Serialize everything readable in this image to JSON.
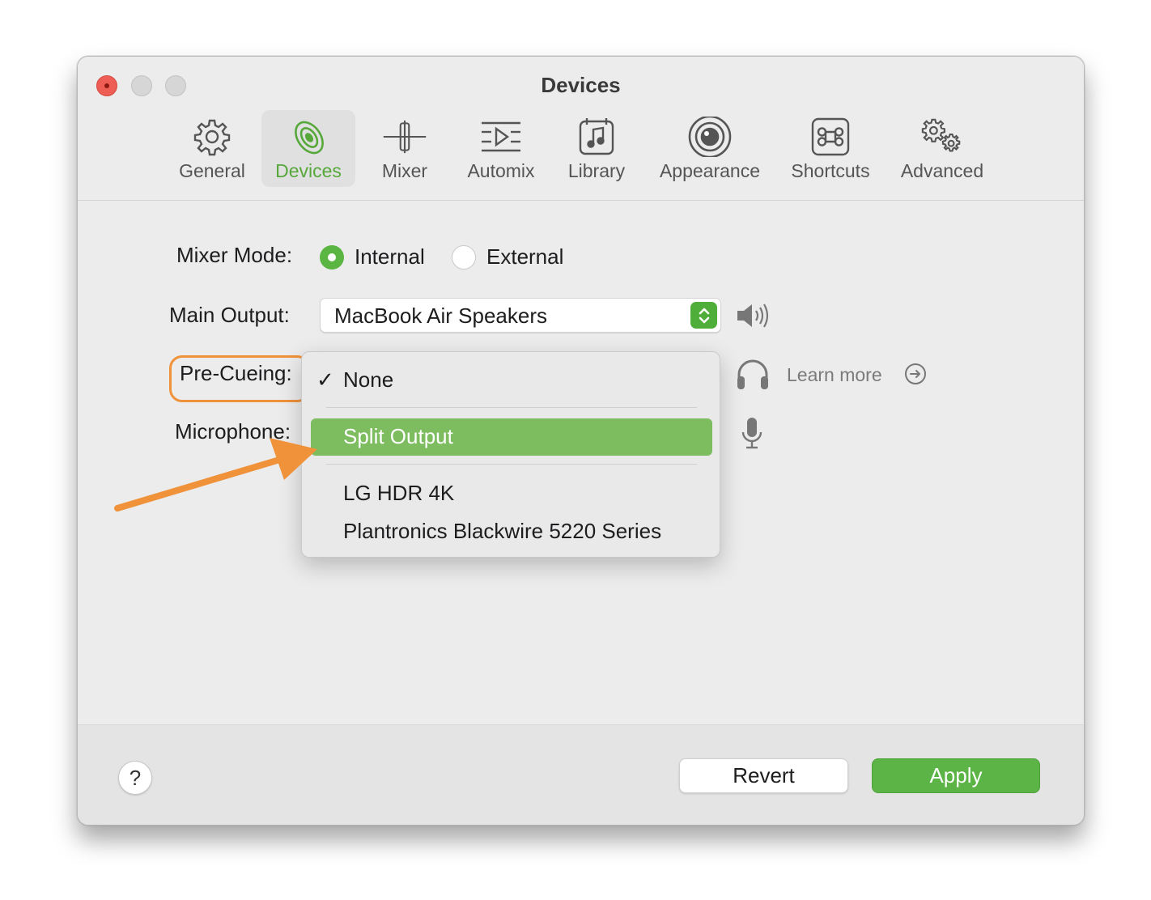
{
  "window": {
    "title": "Devices"
  },
  "toolbar": {
    "tabs": [
      {
        "label": "General",
        "icon": "gear-icon",
        "active": false
      },
      {
        "label": "Devices",
        "icon": "speaker-icon",
        "active": true
      },
      {
        "label": "Mixer",
        "icon": "fader-icon",
        "active": false
      },
      {
        "label": "Automix",
        "icon": "automix-icon",
        "active": false
      },
      {
        "label": "Library",
        "icon": "music-note-icon",
        "active": false
      },
      {
        "label": "Appearance",
        "icon": "eye-icon",
        "active": false
      },
      {
        "label": "Shortcuts",
        "icon": "command-key-icon",
        "active": false
      },
      {
        "label": "Advanced",
        "icon": "gears-icon",
        "active": false
      }
    ]
  },
  "form": {
    "mixer_mode": {
      "label": "Mixer Mode:",
      "options": [
        "Internal",
        "External"
      ],
      "selected": "Internal"
    },
    "main_output": {
      "label": "Main Output:",
      "value": "MacBook Air Speakers"
    },
    "pre_cueing": {
      "label": "Pre-Cueing:",
      "learn_more": "Learn more"
    },
    "microphone": {
      "label": "Microphone:"
    }
  },
  "dropdown": {
    "items": [
      {
        "label": "None",
        "checked": true
      },
      {
        "label": "Split Output",
        "highlighted": true
      },
      {
        "label": "LG HDR 4K"
      },
      {
        "label": "Plantronics Blackwire 5220 Series"
      }
    ],
    "check_glyph": "✓"
  },
  "footer": {
    "help": "?",
    "revert": "Revert",
    "apply": "Apply"
  },
  "colors": {
    "accent": "#5cb346",
    "highlight_menu": "#7dbd60",
    "annotation": "#f0923a"
  }
}
